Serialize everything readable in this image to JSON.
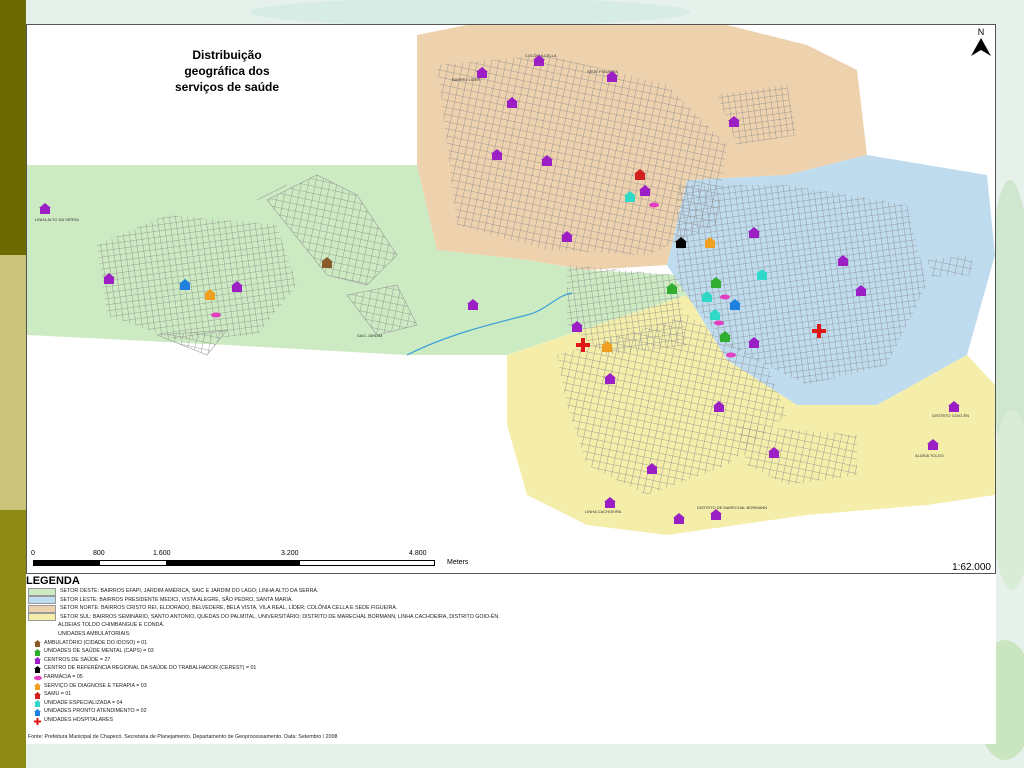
{
  "title": "Distribuição geográfica dos serviços de saúde",
  "north_label": "N",
  "colors": {
    "sector_oeste": "#cdebc2",
    "sector_leste": "#bfdcef",
    "sector_norte": "#eed2ae",
    "sector_sul": "#f4eeaa",
    "strip_dark": "#6b6b00",
    "strip_light": "#c9c47a",
    "centro_saude": "#9b1fc4",
    "caps": "#2fae2f",
    "cerest": "#000000",
    "farmacia": "#e040c0",
    "diagnose": "#f0a020",
    "samu": "#d02020",
    "especializada": "#30d8c8",
    "pronto_atendimento": "#2080e0",
    "hospitalar": "#e01818",
    "ambulatorio": "#8b5a2b"
  },
  "place_labels": {
    "colonia": "COLÔNIA CELLA",
    "figueira": "SEDE FIGUEIRA",
    "lider": "BAIRRO LÍDER",
    "alto_serra": "LINHA ALTO DA SERRA",
    "sede_oeste": "SAIC JARDIM",
    "sul_1": "LINHA CACHOEIRA",
    "sul_2": "DISTRITO DE MARECHAL BORMANN",
    "leste_1": "DISTRITO GOIO-ÊN",
    "leste_2": "ALDEIA TOLDO"
  },
  "scale": {
    "ticks": [
      "0",
      "800",
      "1.600",
      "3.200",
      "4.800"
    ],
    "unit": "Meters",
    "ratio": "1:62.000"
  },
  "legend": {
    "title": "LEGENDA",
    "sectors": [
      {
        "label": "SETOR OESTE: BAIRROS EFAPI, JARDIM AMÉRICA, SAIC E JARDIM DO LAGO; LINHA ALTO DA SERRA.",
        "color": "#cdebc2"
      },
      {
        "label": "SETOR LESTE: BAIRROS PRESIDENTE MEDICI, VISTA ALEGRE, SÃO PEDRO, SANTA MARIA.",
        "color": "#bfdcef"
      },
      {
        "label": "SETOR NORTE: BAIRROS CRISTO REI, ELDORADO, BELVEDERE, BELA VISTA, VILA REAL, LÍDER; COLÔNIA CELLA E SEDE FIGUEIRA.",
        "color": "#eed2ae"
      },
      {
        "label": "SETOR SUL: BAIRROS SEMINÁRIO, SANTO ANTONIO, QUEDAS DO PALMITAL, UNIVERSITÁRIO; DISTRITO DE MARECHAL BORMANN, LINHA CACHOEIRA, DISTRITO GOIO-ÊN.",
        "color": "#f4eeaa"
      }
    ],
    "extra_1": "ALDEIAS TOLDO CHIMBANGUE E CONDÁ.",
    "extra_2": "UNIDADES AMBULATORIAIS:",
    "units": [
      {
        "label": "AMBULATÓRIO (CIDADE DO IDOSO) = 01",
        "color": "#8b5a2b",
        "icon": "house-icon"
      },
      {
        "label": "UNIDADES DE SAÚDE MENTAL (CAPS) = 03",
        "color": "#2fae2f",
        "icon": "house-icon"
      },
      {
        "label": "CENTROS DE SAÚDE = 27",
        "color": "#9b1fc4",
        "icon": "house-icon"
      },
      {
        "label": "CENTRO DE REFERÊNCIA REGIONAL DA SAÚDE DO TRABALHADOR (CEREST) = 01",
        "color": "#000000",
        "icon": "house-icon"
      },
      {
        "label": "FARMÁCIA = 05",
        "color": "#e040c0",
        "icon": "pill-icon"
      },
      {
        "label": "SERVIÇO DE DIAGNOSE E TERAPIA = 03",
        "color": "#f0a020",
        "icon": "house-icon"
      },
      {
        "label": "SAMU = 01",
        "color": "#d02020",
        "icon": "house-icon"
      },
      {
        "label": "UNIDADE ESPECIALIZADA = 04",
        "color": "#30d8c8",
        "icon": "house-icon"
      },
      {
        "label": "UNIDADES PRONTO ATENDIMENTO = 02",
        "color": "#2080e0",
        "icon": "house-icon"
      },
      {
        "label": "UNIDADES HOSPITALARES",
        "color": "#e01818",
        "icon": "cross-icon"
      }
    ],
    "source": "Fonte: Prefeitura Municipal de Chapecó. Secretaria de Planejamento. Departamento de Geoprocessamento. Data: Setembro / 2008"
  }
}
